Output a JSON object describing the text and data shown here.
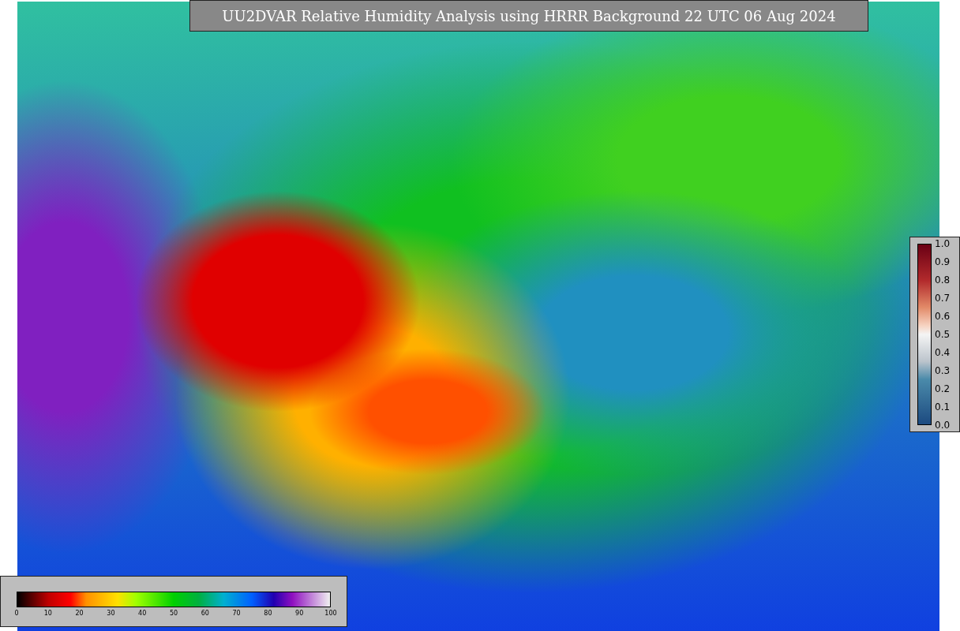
{
  "title": "UU2DVAR Relative Humidity Analysis using HRRR Background 22 UTC 06 Aug 2024",
  "ratio_legend": {
    "ticks": [
      "1.0",
      "0.9",
      "0.8",
      "0.7",
      "0.6",
      "0.5",
      "0.4",
      "0.3",
      "0.2",
      "0.1",
      "0.0"
    ]
  },
  "percent_legend": {
    "ticks": [
      "0",
      "10",
      "20",
      "30",
      "40",
      "50",
      "60",
      "70",
      "80",
      "90",
      "100"
    ]
  }
}
